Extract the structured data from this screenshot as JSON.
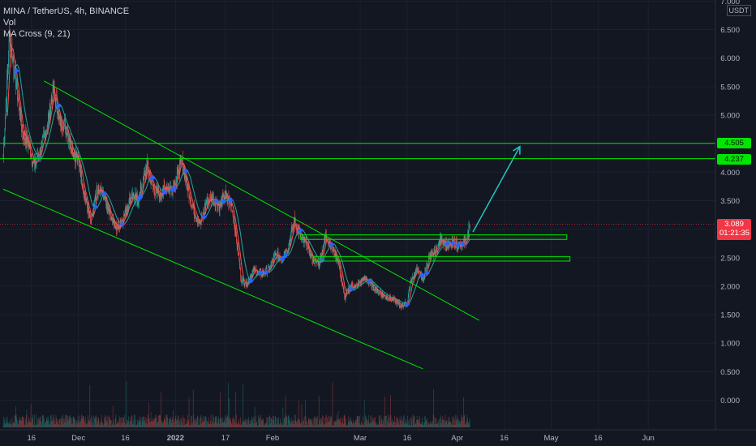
{
  "legend": {
    "symbol": "MINA / TetherUS, 4h, BINANCE",
    "vol": "Vol",
    "ma": "MA Cross (9, 21)"
  },
  "price_axis": {
    "unit": "USDT",
    "ticks": [
      "7.000",
      "6.500",
      "6.000",
      "5.500",
      "5.000",
      "4.500",
      "4.000",
      "3.500",
      "3.000",
      "2.500",
      "2.000",
      "1.500",
      "1.000",
      "0.500",
      "0.000"
    ]
  },
  "time_axis": {
    "ticks": [
      "16",
      "Dec",
      "16",
      "2022",
      "17",
      "Feb",
      "Mar",
      "16",
      "Apr",
      "16",
      "May",
      "16",
      "Jun"
    ]
  },
  "tags": {
    "level_upper": "4.505",
    "level_lower": "4.237",
    "last_price": "3.089",
    "countdown": "01:21:35"
  },
  "colors": {
    "background": "#131722",
    "up": "#26a69a",
    "down": "#ef5350",
    "ma_fast": "#ef5350",
    "ma_slow": "#26a69a",
    "cross": "#2962ff",
    "drawing": "#00e600",
    "arrow": "#22c4c4"
  },
  "chart_data": {
    "type": "line",
    "title": "MINA / TetherUS, 4h, BINANCE",
    "ylabel": "USDT",
    "ylim": [
      0,
      7
    ],
    "horizontal_levels": [
      4.505,
      4.237
    ],
    "last_price": 3.089,
    "series": [
      {
        "name": "MINA / TetherUS",
        "points": [
          [
            "2021-11-07",
            4.3
          ],
          [
            "2021-11-09",
            6.4
          ],
          [
            "2021-11-11",
            5.6
          ],
          [
            "2021-11-13",
            4.7
          ],
          [
            "2021-11-15",
            4.5
          ],
          [
            "2021-11-17",
            4.1
          ],
          [
            "2021-11-19",
            4.4
          ],
          [
            "2021-11-21",
            4.8
          ],
          [
            "2021-11-23",
            5.45
          ],
          [
            "2021-11-25",
            4.9
          ],
          [
            "2021-11-27",
            4.8
          ],
          [
            "2021-11-29",
            4.4
          ],
          [
            "2021-12-01",
            4.2
          ],
          [
            "2021-12-03",
            3.6
          ],
          [
            "2021-12-05",
            3.1
          ],
          [
            "2021-12-07",
            3.7
          ],
          [
            "2021-12-09",
            3.6
          ],
          [
            "2021-12-11",
            3.3
          ],
          [
            "2021-12-13",
            3.0
          ],
          [
            "2021-12-15",
            3.15
          ],
          [
            "2021-12-18",
            3.6
          ],
          [
            "2021-12-20",
            3.5
          ],
          [
            "2021-12-23",
            4.1
          ],
          [
            "2021-12-25",
            3.7
          ],
          [
            "2021-12-27",
            3.6
          ],
          [
            "2021-12-29",
            3.75
          ],
          [
            "2021-12-31",
            3.7
          ],
          [
            "2022-01-03",
            4.2
          ],
          [
            "2022-01-05",
            3.7
          ],
          [
            "2022-01-07",
            3.3
          ],
          [
            "2022-01-09",
            3.1
          ],
          [
            "2022-01-11",
            3.5
          ],
          [
            "2022-01-13",
            3.55
          ],
          [
            "2022-01-15",
            3.4
          ],
          [
            "2022-01-17",
            3.6
          ],
          [
            "2022-01-19",
            3.4
          ],
          [
            "2022-01-21",
            2.6
          ],
          [
            "2022-01-22",
            2.1
          ],
          [
            "2022-01-24",
            2.05
          ],
          [
            "2022-01-26",
            2.3
          ],
          [
            "2022-01-28",
            2.2
          ],
          [
            "2022-01-31",
            2.3
          ],
          [
            "2022-02-02",
            2.55
          ],
          [
            "2022-02-04",
            2.5
          ],
          [
            "2022-02-06",
            2.7
          ],
          [
            "2022-02-08",
            3.15
          ],
          [
            "2022-02-10",
            2.85
          ],
          [
            "2022-02-12",
            2.7
          ],
          [
            "2022-02-14",
            2.45
          ],
          [
            "2022-02-16",
            2.4
          ],
          [
            "2022-02-18",
            2.9
          ],
          [
            "2022-02-20",
            2.65
          ],
          [
            "2022-02-22",
            2.45
          ],
          [
            "2022-02-24",
            1.8
          ],
          [
            "2022-02-26",
            2.0
          ],
          [
            "2022-02-28",
            2.0
          ],
          [
            "2022-03-02",
            2.15
          ],
          [
            "2022-03-04",
            2.05
          ],
          [
            "2022-03-06",
            1.95
          ],
          [
            "2022-03-08",
            1.85
          ],
          [
            "2022-03-10",
            1.8
          ],
          [
            "2022-03-12",
            1.75
          ],
          [
            "2022-03-14",
            1.65
          ],
          [
            "2022-03-16",
            1.7
          ],
          [
            "2022-03-17",
            2.05
          ],
          [
            "2022-03-19",
            2.3
          ],
          [
            "2022-03-21",
            2.1
          ],
          [
            "2022-03-23",
            2.5
          ],
          [
            "2022-03-25",
            2.6
          ],
          [
            "2022-03-27",
            2.85
          ],
          [
            "2022-03-29",
            2.7
          ],
          [
            "2022-03-31",
            2.75
          ],
          [
            "2022-04-02",
            2.7
          ],
          [
            "2022-04-04",
            2.8
          ],
          [
            "2022-04-05",
            3.089
          ]
        ]
      }
    ],
    "drawings": {
      "channel_upper": [
        [
          "2021-11-20",
          5.6
        ],
        [
          "2022-04-08",
          1.4
        ]
      ],
      "channel_lower": [
        [
          "2021-11-07",
          3.7
        ],
        [
          "2022-03-21",
          0.55
        ]
      ],
      "zone_upper": [
        [
          "2022-02-10",
          2.82
        ],
        [
          "2022-05-06",
          2.9
        ]
      ],
      "zone_lower": [
        [
          "2022-02-14",
          2.44
        ],
        [
          "2022-05-07",
          2.52
        ]
      ],
      "projection_arrow": [
        [
          "2022-04-06",
          2.95
        ],
        [
          "2022-04-21",
          4.45
        ]
      ]
    }
  }
}
